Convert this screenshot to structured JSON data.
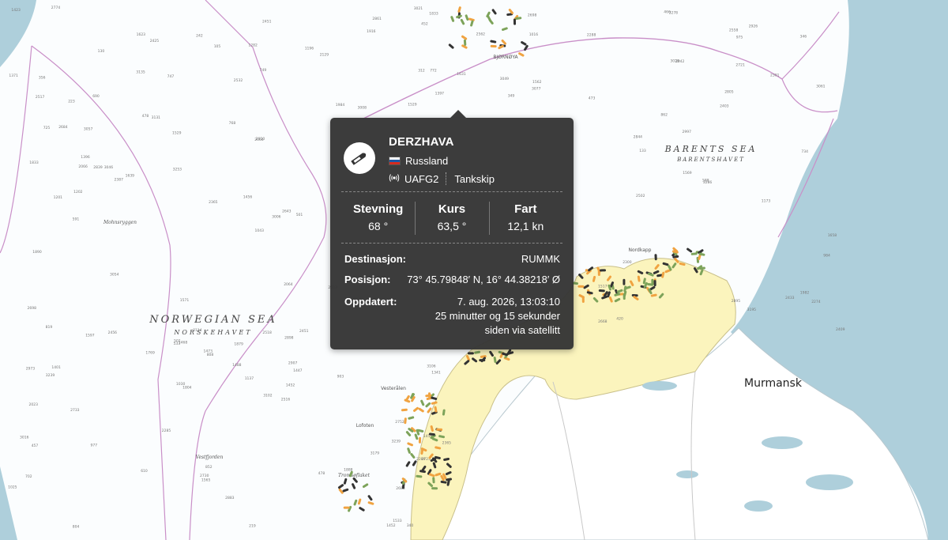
{
  "map": {
    "labels": {
      "norwegian_sea": "NORWEGIAN SEA",
      "norskehavet": "NORSKEHAVET",
      "barents_sea": "BARENTS SEA",
      "barentshavet": "BARENTSHAVET",
      "murmansk": "Murmansk",
      "bjornoya": "BJØRNØYA",
      "tromsoflaket": "Tromsøflaket",
      "nordkapp": "Nordkapp",
      "lofoten": "Lofoten",
      "vesteralen": "Vesterålen",
      "mohnsryggen": "Mohnsryggen",
      "vestfjorden": "Vestfjorden"
    },
    "colors": {
      "sea": "#fbfdfe",
      "deep_ocean": "#aecfdb",
      "land_norway": "#fbf4bd",
      "land_other": "#ffffff",
      "boundary": "#c98fc8",
      "vessel_cargo": "#7da35a",
      "vessel_fishing": "#f0a341",
      "vessel_other": "#333333"
    }
  },
  "popup": {
    "icon": "ship-icon",
    "name": "DERZHAVA",
    "flag_country": "Russland",
    "flag_icon": "russia-flag-icon",
    "callsign_icon": "radio-signal-icon",
    "callsign": "UAFG2",
    "ship_type": "Tankskip",
    "stats": [
      {
        "label": "Stevning",
        "value": "68 °"
      },
      {
        "label": "Kurs",
        "value": "63,5 °"
      },
      {
        "label": "Fart",
        "value": "12,1 kn"
      }
    ],
    "destination_label": "Destinasjon:",
    "destination_value": "RUMMK",
    "position_label": "Posisjon:",
    "position_value": "73° 45.79848′ N, 16° 44.38218′ Ø",
    "updated_label": "Oppdatert:",
    "updated_line1": "7. aug. 2026, 13:03:10",
    "updated_line2": "25 minutter og 15 sekunder",
    "updated_line3": "siden via satellitt"
  }
}
